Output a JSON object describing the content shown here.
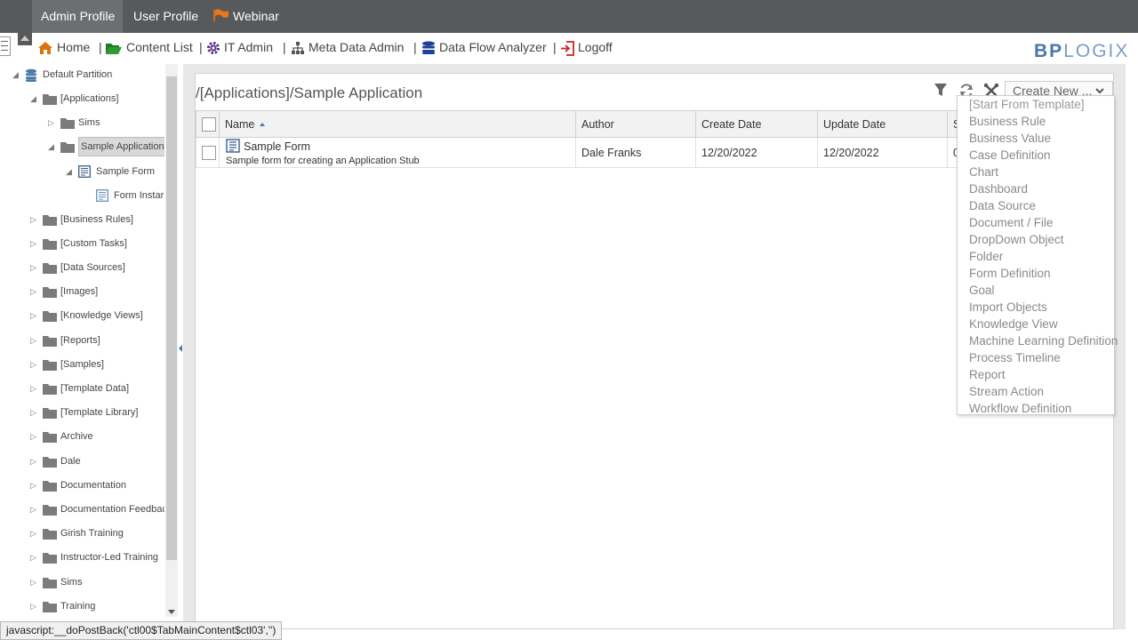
{
  "tabs": {
    "admin_profile": "Admin Profile",
    "user_profile": "User Profile",
    "webinar": "Webinar"
  },
  "nav": {
    "items": [
      {
        "label": "Home",
        "icon": "home-icon"
      },
      {
        "label": "Content List",
        "icon": "folder-open-icon"
      },
      {
        "label": "IT Admin",
        "icon": "gear-icon"
      },
      {
        "label": "Meta Data Admin",
        "icon": "sitemap-icon"
      },
      {
        "label": "Data Flow Analyzer",
        "icon": "database-icon"
      },
      {
        "label": "Logoff",
        "icon": "logoff-icon"
      }
    ],
    "separator": "|"
  },
  "logo": {
    "bp": "BP",
    "logix": "LOGIX"
  },
  "tree": {
    "items": [
      {
        "label": "Default Partition",
        "expanded": true
      },
      {
        "label": "[Applications]",
        "expanded": true
      },
      {
        "label": "Sims"
      },
      {
        "label": "Sample Application",
        "selected": true,
        "expanded": true
      },
      {
        "label": "Sample Form",
        "expanded": true
      },
      {
        "label": "Form Instar"
      },
      {
        "label": "[Business Rules]"
      },
      {
        "label": "[Custom Tasks]"
      },
      {
        "label": "[Data Sources]"
      },
      {
        "label": "[Images]"
      },
      {
        "label": "[Knowledge Views]"
      },
      {
        "label": "[Reports]"
      },
      {
        "label": "[Samples]"
      },
      {
        "label": "[Template Data]"
      },
      {
        "label": "[Template Library]"
      },
      {
        "label": "Archive"
      },
      {
        "label": "Dale"
      },
      {
        "label": "Documentation"
      },
      {
        "label": "Documentation Feedbac"
      },
      {
        "label": "Girish Training"
      },
      {
        "label": "Instructor-Led Training"
      },
      {
        "label": "Sims"
      },
      {
        "label": "Training"
      }
    ]
  },
  "content": {
    "path": "/[Applications]/Sample Application",
    "create_new": "Create New ..."
  },
  "grid": {
    "columns": [
      "Name",
      "Author",
      "Create Date",
      "Update Date",
      "S"
    ],
    "rows": [
      {
        "name": "Sample Form",
        "description": "Sample form for creating an Application Stub",
        "author": "Dale Franks",
        "create_date": "12/20/2022",
        "update_date": "12/20/2022",
        "s": "0"
      }
    ]
  },
  "create_menu": {
    "options": [
      "[Start From Template]",
      "Business Rule",
      "Business Value",
      "Case Definition",
      "Chart",
      "Dashboard",
      "Data Source",
      "Document / File",
      "DropDown Object",
      "Folder",
      "Form Definition",
      "Goal",
      "Import Objects",
      "Knowledge View",
      "Machine Learning Definition",
      "Process Timeline",
      "Report",
      "Stream Action",
      "Workflow Definition"
    ]
  },
  "status": "javascript:__doPostBack('ctl00$TabMainContent$ctl03','')",
  "colors": {
    "topbar": "#58595b",
    "accent": "#4a78a8",
    "home_icon": "#d9730d",
    "folder_icon": "#2e9b2e",
    "gear_icon": "#5a2d82",
    "database_icon": "#1f3f99",
    "logoff_icon": "#cc2222"
  }
}
